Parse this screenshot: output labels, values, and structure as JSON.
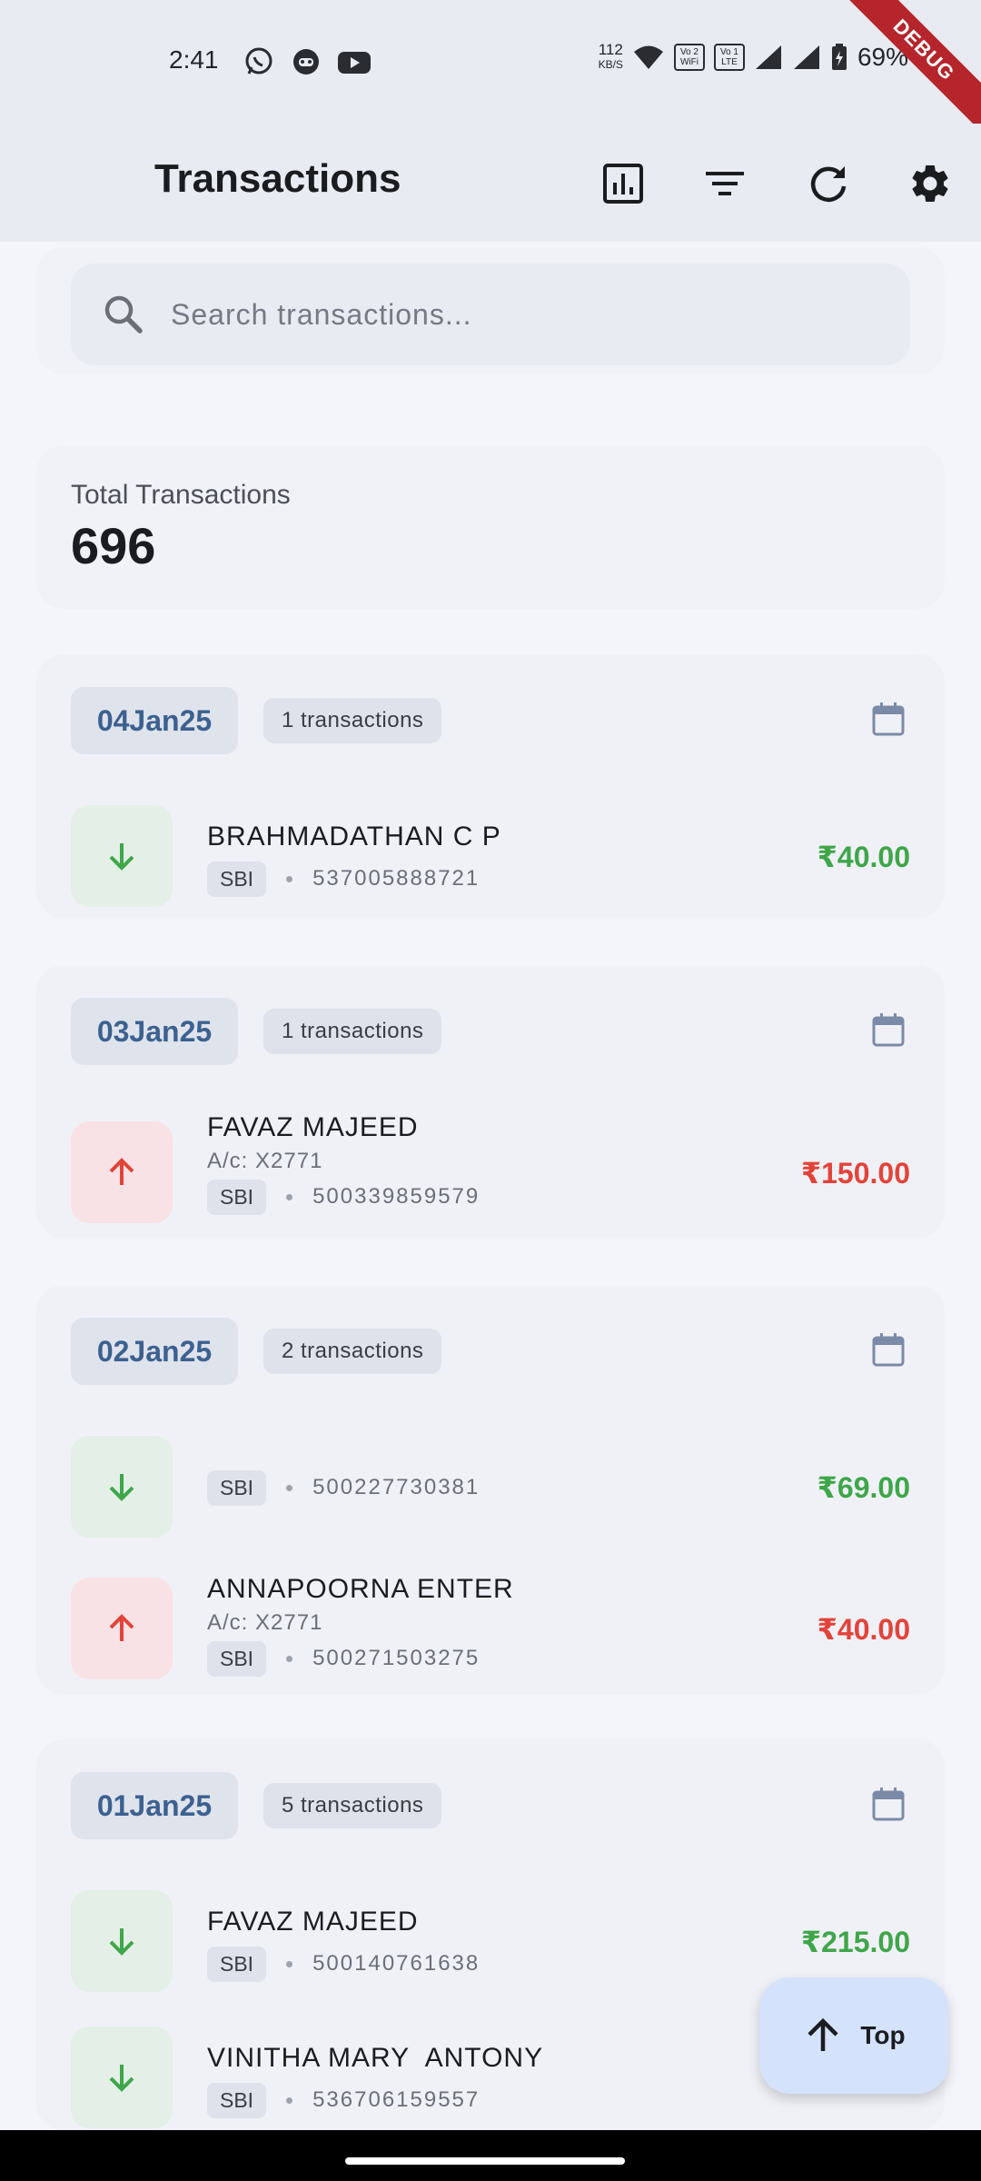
{
  "status_bar": {
    "time": "2:41",
    "speed_value": "112",
    "speed_unit": "KB/S",
    "vowifi_label": "Vo 2 WiFi",
    "volte_label": "Vo 1 LTE",
    "battery": "69%",
    "app_icons": [
      "whatsapp-icon",
      "robot-face-icon",
      "youtube-icon"
    ]
  },
  "debug_banner": "DEBUG",
  "app_bar": {
    "title": "Transactions",
    "actions": [
      "chart-icon",
      "filter-icon",
      "refresh-icon",
      "settings-icon"
    ]
  },
  "search": {
    "placeholder": "Search transactions..."
  },
  "summary": {
    "label": "Total Transactions",
    "value": "696"
  },
  "groups": [
    {
      "date": "04Jan25",
      "count_label": "1 transactions",
      "transactions": [
        {
          "direction": "in",
          "name": "BRAHMADATHAN C P",
          "bank": "SBI",
          "ref": "537005888721",
          "amount": "₹40.00"
        }
      ]
    },
    {
      "date": "03Jan25",
      "count_label": "1 transactions",
      "transactions": [
        {
          "direction": "out",
          "name": "FAVAZ MAJEED",
          "account": "A/c: X2771",
          "bank": "SBI",
          "ref": "500339859579",
          "amount": "₹150.00"
        }
      ]
    },
    {
      "date": "02Jan25",
      "count_label": "2 transactions",
      "transactions": [
        {
          "direction": "in",
          "bank": "SBI",
          "ref": "500227730381",
          "amount": "₹69.00"
        },
        {
          "direction": "out",
          "name": "ANNAPOORNA ENTER",
          "account": "A/c: X2771",
          "bank": "SBI",
          "ref": "500271503275",
          "amount": "₹40.00"
        }
      ]
    },
    {
      "date": "01Jan25",
      "count_label": "5 transactions",
      "transactions": [
        {
          "direction": "in",
          "name": "FAVAZ MAJEED",
          "bank": "SBI",
          "ref": "500140761638",
          "amount": "₹215.00"
        },
        {
          "direction": "in",
          "name": "VINITHA MARY  ANTONY",
          "bank": "SBI",
          "ref": "536706159557"
        }
      ]
    }
  ],
  "fab": {
    "label": "Top"
  },
  "colors": {
    "credit": "#3fa64a",
    "debit": "#e2443a",
    "date_chip_text": "#3c6190",
    "fab_bg": "#d4e3fb"
  }
}
